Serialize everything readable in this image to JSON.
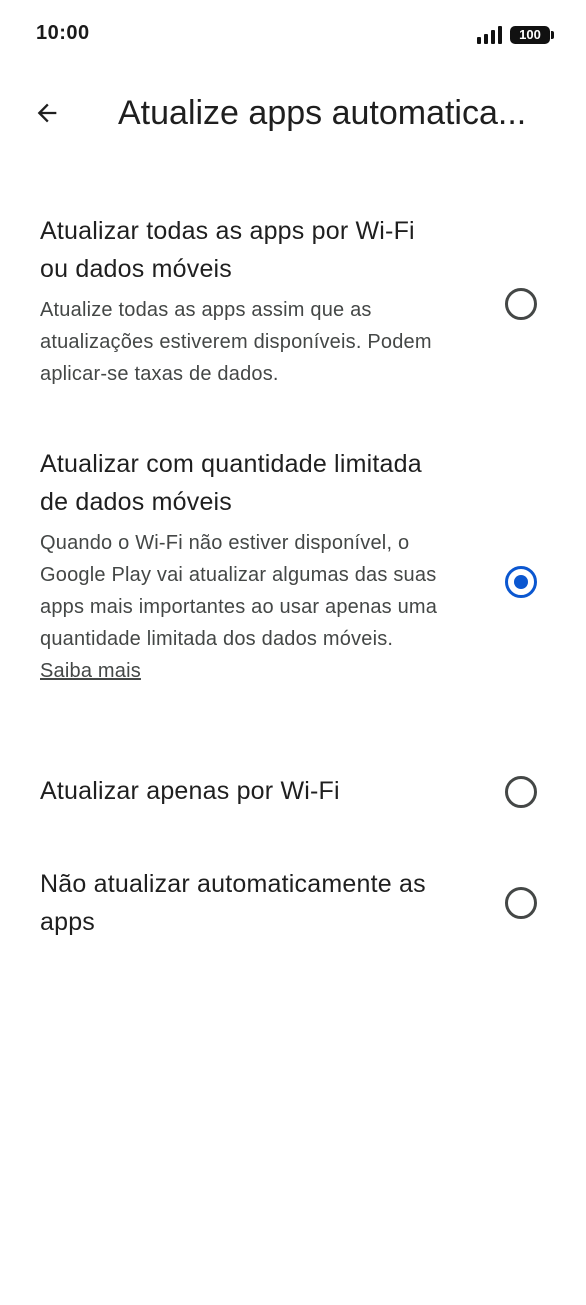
{
  "status_bar": {
    "time": "10:00",
    "battery": "100"
  },
  "app_bar": {
    "back_icon": "arrow-back-icon",
    "title": "Atualize apps automatica..."
  },
  "options": [
    {
      "title": "Atualizar todas as apps por Wi-Fi ou dados móveis",
      "description": "Atualize todas as apps assim que as atualizações estiverem disponíveis. Podem aplicar-se taxas de dados.",
      "selected": false
    },
    {
      "title": "Atualizar com quantidade limitada de dados móveis",
      "description": "Quando o Wi-Fi não estiver disponível, o Google Play vai atualizar algumas das suas apps mais importantes ao usar apenas uma quantidade limitada dos dados móveis.",
      "link": "Saiba mais",
      "selected": true
    },
    {
      "title": "Atualizar apenas por Wi-Fi",
      "selected": false
    },
    {
      "title": "Não atualizar automaticamente as apps",
      "selected": false
    }
  ],
  "colors": {
    "accent": "#0b57d0",
    "text_primary": "#1f1f1f",
    "text_secondary": "#444746"
  }
}
